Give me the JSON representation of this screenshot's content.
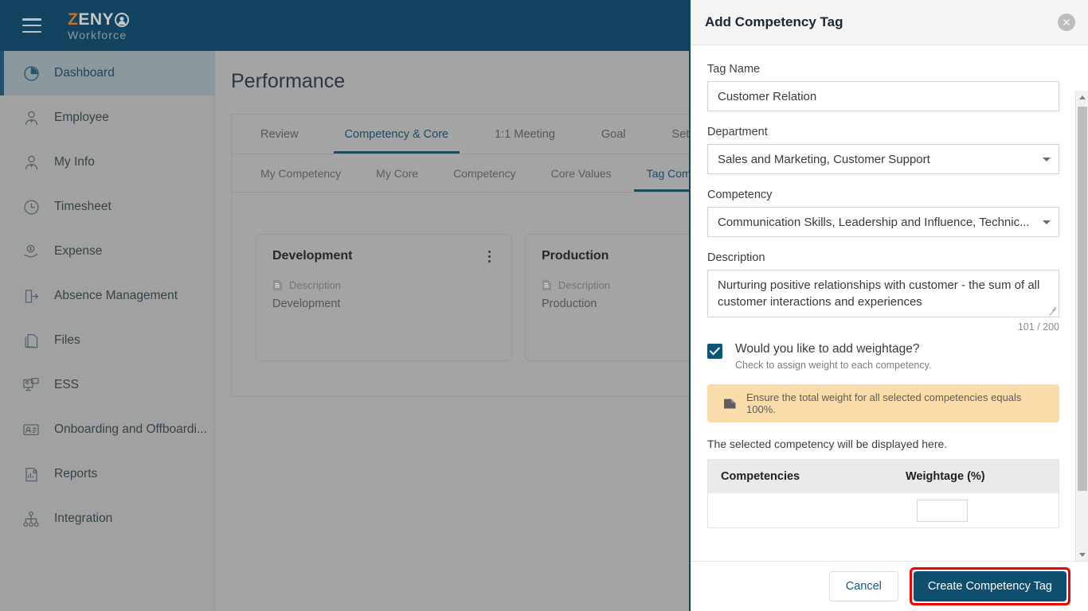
{
  "topbar": {
    "menu_icon": "hamburger-icon",
    "logo_primary": "Z",
    "logo_secondary": "ENY",
    "logo_sub": "Workforce"
  },
  "sidebar": {
    "items": [
      {
        "label": "Dashboard",
        "icon": "pie-chart-icon",
        "active": true
      },
      {
        "label": "Employee",
        "icon": "user-tie-icon",
        "active": false
      },
      {
        "label": "My Info",
        "icon": "user-tie-icon",
        "active": false
      },
      {
        "label": "Timesheet",
        "icon": "clock-icon",
        "active": false
      },
      {
        "label": "Expense",
        "icon": "money-hand-icon",
        "active": false
      },
      {
        "label": "Absence Management",
        "icon": "door-exit-icon",
        "active": false
      },
      {
        "label": "Files",
        "icon": "files-icon",
        "active": false
      },
      {
        "label": "ESS",
        "icon": "self-service-icon",
        "active": false
      },
      {
        "label": "Onboarding and Offboardi...",
        "icon": "id-card-icon",
        "active": false
      },
      {
        "label": "Reports",
        "icon": "report-icon",
        "active": false
      },
      {
        "label": "Integration",
        "icon": "sitemap-icon",
        "active": false
      }
    ]
  },
  "main": {
    "page_title": "Performance",
    "tabs_level1": [
      {
        "label": "Review",
        "active": false
      },
      {
        "label": "Competency & Core",
        "active": true
      },
      {
        "label": "1:1 Meeting",
        "active": false
      },
      {
        "label": "Goal",
        "active": false
      },
      {
        "label": "Settings",
        "active": false
      }
    ],
    "tabs_level2": [
      {
        "label": "My Competency",
        "active": false
      },
      {
        "label": "My Core",
        "active": false
      },
      {
        "label": "Competency",
        "active": false
      },
      {
        "label": "Core Values",
        "active": false
      },
      {
        "label": "Tag Com",
        "active": true
      }
    ],
    "cards": [
      {
        "title": "Development",
        "desc_label": "Description",
        "desc_value": "Development",
        "has_menu": true
      },
      {
        "title": "Production",
        "desc_label": "Description",
        "desc_value": "Production",
        "has_menu": false
      }
    ]
  },
  "dialog": {
    "title": "Add Competency Tag",
    "close_icon": "close-icon",
    "tag_name": {
      "label": "Tag Name",
      "value": "Customer Relation",
      "placeholder": "Tag Name"
    },
    "department": {
      "label": "Department",
      "value": "Sales and Marketing, Customer Support"
    },
    "competency": {
      "label": "Competency",
      "value": "Communication Skills, Leadership and Influence, Technic..."
    },
    "description": {
      "label": "Description",
      "value": "Nurturing positive relationships with customer - the sum of all customer interactions and experiences",
      "char_count": "101 / 200"
    },
    "weightage_check": {
      "checked": true,
      "label": "Would you like to add weightage?",
      "sublabel": "Check to assign weight to each competency."
    },
    "alert": {
      "icon": "note-icon",
      "text": "Ensure the total weight for all selected competencies equals 100%.",
      "bg_color": "#fadcab"
    },
    "helper_text": "The selected competency will be displayed here.",
    "weight_table": {
      "headers": [
        "Competencies",
        "Weightage (%)"
      ],
      "rows": [
        {
          "competency": "",
          "weightage": ""
        }
      ]
    },
    "footer": {
      "cancel_label": "Cancel",
      "submit_label": "Create Competency Tag",
      "submit_color": "#0e4f70",
      "highlight_color": "#f00000"
    }
  }
}
